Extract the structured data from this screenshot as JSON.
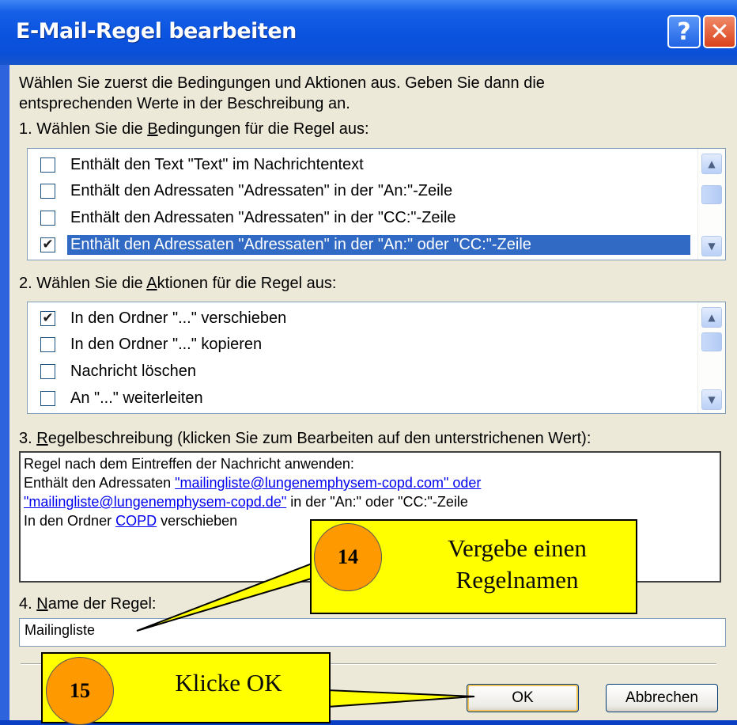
{
  "window": {
    "title": "E-Mail-Regel bearbeiten",
    "help_glyph": "?",
    "close_glyph": "✕"
  },
  "intro": {
    "line1": "Wählen Sie zuerst die Bedingungen und Aktionen aus. Geben Sie dann die",
    "line2": "entsprechenden Werte in der Beschreibung an."
  },
  "conditions": {
    "label_pre": "1. Wählen Sie die ",
    "label_key": "B",
    "label_post": "edingungen für die Regel aus:",
    "items": [
      {
        "label": "Enthält den Text \"Text\" im Nachrichtentext",
        "checked": false,
        "mark": ""
      },
      {
        "label": "Enthält den Adressaten \"Adressaten\" in der \"An:\"-Zeile",
        "checked": false,
        "mark": ""
      },
      {
        "label": "Enthält den Adressaten \"Adressaten\" in der \"CC:\"-Zeile",
        "checked": false,
        "mark": ""
      },
      {
        "label": "Enthält den Adressaten \"Adressaten\" in der \"An:\" oder \"CC:\"-Zeile",
        "checked": true,
        "selected": true,
        "mark": "✔"
      }
    ]
  },
  "actions": {
    "label_pre": "2. Wählen Sie die ",
    "label_key": "A",
    "label_post": "ktionen für die Regel aus:",
    "items": [
      {
        "label": "In den Ordner \"...\" verschieben",
        "checked": true,
        "mark": "✔"
      },
      {
        "label": "In den Ordner \"...\" kopieren",
        "checked": false,
        "mark": ""
      },
      {
        "label": "Nachricht löschen",
        "checked": false,
        "mark": ""
      },
      {
        "label": "An \"...\" weiterleiten",
        "checked": false,
        "mark": ""
      }
    ]
  },
  "description": {
    "label_pre": "3. ",
    "label_key": "R",
    "label_post": "egelbeschreibung (klicken Sie zum Bearbeiten auf den unterstrichenen Wert):",
    "line1": "Regel nach dem Eintreffen der Nachricht anwenden:",
    "line2_pre": "Enthält den Adressaten ",
    "line2_link": "\"mailingliste@lungenemphysem-copd.com\" oder",
    "line3_link": "\"mailingliste@lungenemphysem-copd.de\"",
    "line3_post": " in der \"An:\" oder \"CC:\"-Zeile",
    "line4_pre": "In den Ordner ",
    "line4_link": "COPD",
    "line4_post": " verschieben"
  },
  "rule_name": {
    "label_pre": "4. ",
    "label_key": "N",
    "label_post": "ame der Regel:",
    "value": "Mailingliste"
  },
  "buttons": {
    "ok": "OK",
    "cancel": "Abbrechen"
  },
  "scroll_glyphs": {
    "up": "▲",
    "down": "▼"
  },
  "callouts": [
    {
      "number": "14",
      "line1": "Vergebe einen",
      "line2": "Regelnamen"
    },
    {
      "number": "15",
      "line1": "Klicke OK"
    }
  ],
  "colors": {
    "selection": "#316ac5",
    "callout_bg": "#ffff00",
    "badge": "#ff9900",
    "link": "#0000ee"
  }
}
